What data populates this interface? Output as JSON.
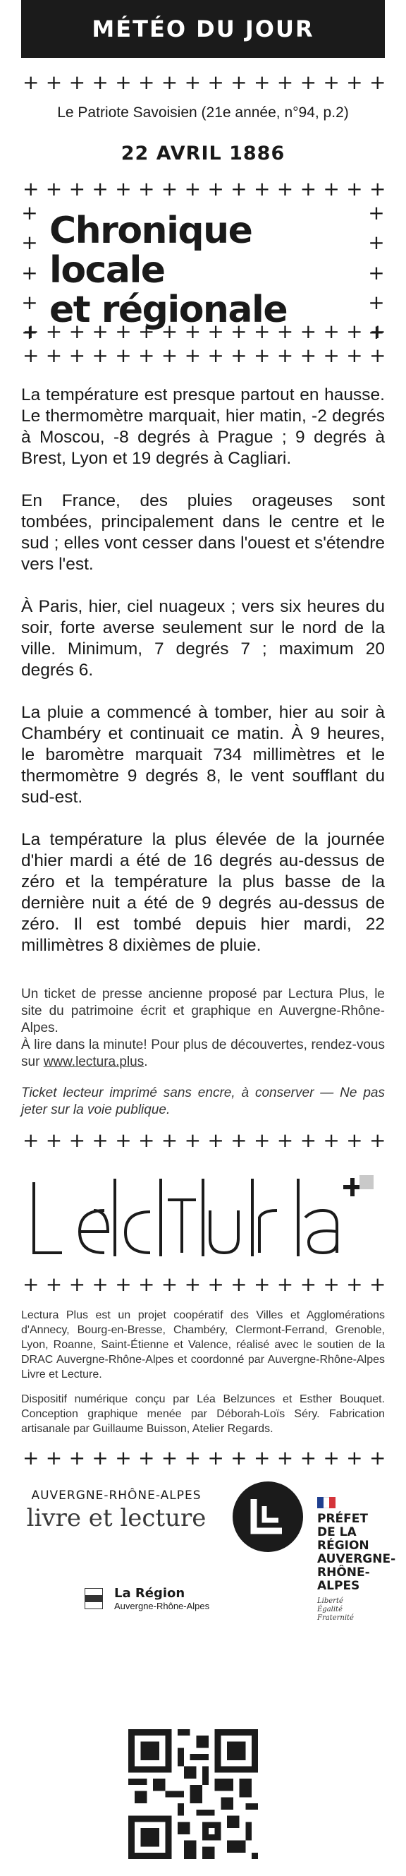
{
  "header": {
    "title": "MÉTÉO DU JOUR"
  },
  "source": "Le Patriote Savoisien (21e année, n°94, p.2)",
  "date": "22 AVRIL 1886",
  "title_lines": [
    "Chronique",
    "locale",
    "et régionale"
  ],
  "paragraphs": [
    "La température est presque partout en hausse. Le thermomètre marquait, hier matin, -2 degrés à Moscou, -8 degrés à Prague ; 9 degrés à Brest, Lyon et 19 degrés à Cagliari.",
    "En France, des pluies orageuses sont tombées, principalement dans le centre et le sud ; elles vont cesser dans l'ouest et s'étendre vers l'est.",
    "À Paris, hier, ciel nuageux ; vers six heures du soir, forte averse seulement sur le nord de la ville. Minimum, 7 degrés 7 ; maximum 20 degrés 6.",
    "La pluie a commencé à tomber, hier au soir à Chambéry et continuait ce matin. À 9 heures, le baromètre marquait 734 millimètres et le thermomètre 9 degrés 8, le vent soufflant du sud-est.",
    "La température la plus élevée de la journée d'hier mardi a été de 16 degrés au-dessus de zéro et la température la plus basse de la dernière nuit a été de 9 degrés au-dessus de zéro. Il est tombé depuis hier mardi, 22 millimètres 8 dixièmes de pluie."
  ],
  "ticket_info": {
    "line1": "Un ticket de presse ancienne proposé par Lectura Plus, le site du patrimoine écrit et graphique en Auvergne-Rhône-Alpes.",
    "line2_prefix": "À lire dans la minute! Pour plus de découvertes, rendez-vous sur ",
    "link": "www.lectura.plus",
    "line2_suffix": "."
  },
  "ticket_note": "Ticket lecteur imprimé sans encre, à conserver — Ne pas jeter sur la voie publique.",
  "credits": [
    "Lectura Plus est un projet coopératif des Villes et Agglomérations d'Annecy, Bourg-en-Bresse, Chambéry, Clermont-Ferrand, Grenoble, Lyon, Roanne, Saint-Étienne et Valence, réalisé avec le soutien de la DRAC Auvergne-Rhône-Alpes et coordonné par Auvergne-Rhône-Alpes Livre et Lecture.",
    "Dispositif numérique conçu par Léa Belzunces et Esther Bouquet. Conception graphique menée par Déborah-Loïs Séry. Fabrication artisanale par Guillaume Buisson, Atelier Regards."
  ],
  "partners": {
    "arl_top": "AUVERGNE-RHÔNE-ALPES",
    "arl_bottom": "livre et lecture",
    "region_name": "La Région",
    "region_sub": "Auvergne-Rhône-Alpes",
    "prefet": [
      "PRÉFET",
      "DE LA RÉGION",
      "AUVERGNE-",
      "RHÔNE-ALPES"
    ],
    "motto": [
      "Liberté",
      "Égalité",
      "Fraternité"
    ]
  },
  "colors": {
    "ink": "#1b1b1b",
    "flag_blue": "#1f3f8f",
    "flag_red": "#d4343a"
  }
}
